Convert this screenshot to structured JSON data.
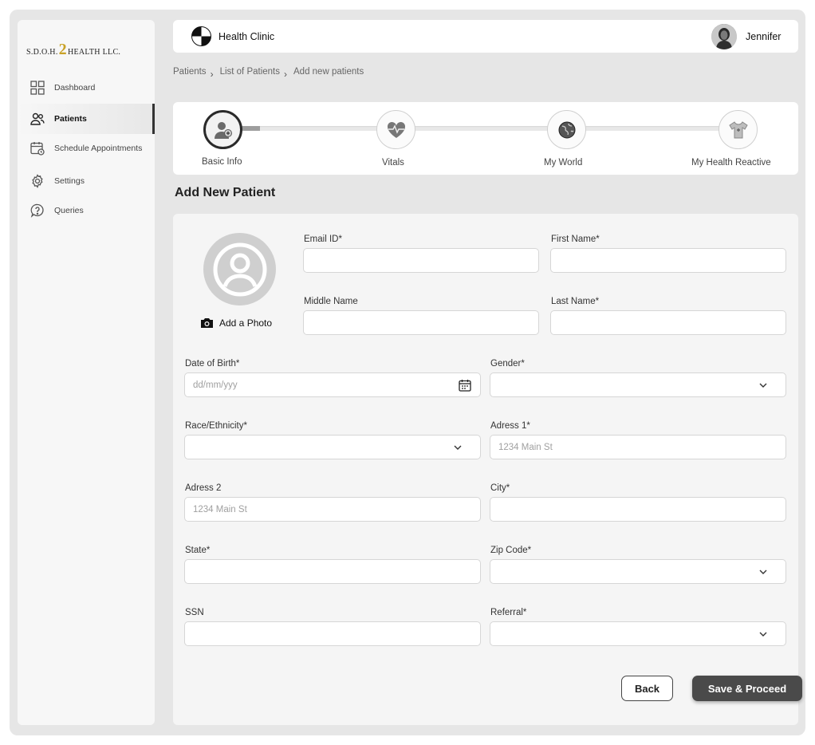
{
  "brand": {
    "logo_left": "S.D.O.H.",
    "logo_two": "2",
    "logo_right": "HEALTH LLC."
  },
  "sidebar": {
    "items": [
      {
        "label": "Dashboard",
        "icon": "grid-icon"
      },
      {
        "label": "Patients",
        "icon": "users-icon",
        "active": true
      },
      {
        "label": "Schedule Appointments",
        "icon": "calendar-clock-icon"
      },
      {
        "label": "Settings",
        "icon": "gear-icon"
      },
      {
        "label": "Queries",
        "icon": "question-icon"
      }
    ]
  },
  "header": {
    "clinic_name": "Health Clinic",
    "user_name": "Jennifer"
  },
  "breadcrumb": [
    "Patients",
    "List of Patients",
    "Add new patients"
  ],
  "stepper": {
    "steps": [
      {
        "label": "Basic Info",
        "icon": "user-add-icon",
        "active": true
      },
      {
        "label": "Vitals",
        "icon": "heart-pulse-icon"
      },
      {
        "label": "My World",
        "icon": "globe-icon"
      },
      {
        "label": "My Health Reactive",
        "icon": "shirt-icon"
      }
    ]
  },
  "page_title": "Add New Patient",
  "form": {
    "add_photo": "Add a Photo",
    "email": {
      "label": "Email ID*",
      "value": "",
      "placeholder": ""
    },
    "first_name": {
      "label": "First Name*",
      "value": "",
      "placeholder": ""
    },
    "middle_name": {
      "label": "Middle Name",
      "value": "",
      "placeholder": ""
    },
    "last_name": {
      "label": "Last Name*",
      "value": "",
      "placeholder": ""
    },
    "dob": {
      "label": "Date of Birth*",
      "placeholder": "dd/mm/yyy"
    },
    "gender": {
      "label": "Gender*",
      "value": ""
    },
    "race": {
      "label": "Race/Ethnicity*",
      "value": ""
    },
    "address1": {
      "label": "Adress 1*",
      "placeholder": "1234 Main St"
    },
    "address2": {
      "label": "Adress 2",
      "placeholder": "1234 Main St"
    },
    "city": {
      "label": "City*",
      "placeholder": ""
    },
    "state": {
      "label": "State*",
      "placeholder": ""
    },
    "zip": {
      "label": "Zip Code*",
      "value": ""
    },
    "ssn": {
      "label": "SSN",
      "placeholder": ""
    },
    "referral": {
      "label": "Referral*",
      "value": ""
    }
  },
  "buttons": {
    "back": "Back",
    "save": "Save & Proceed"
  }
}
